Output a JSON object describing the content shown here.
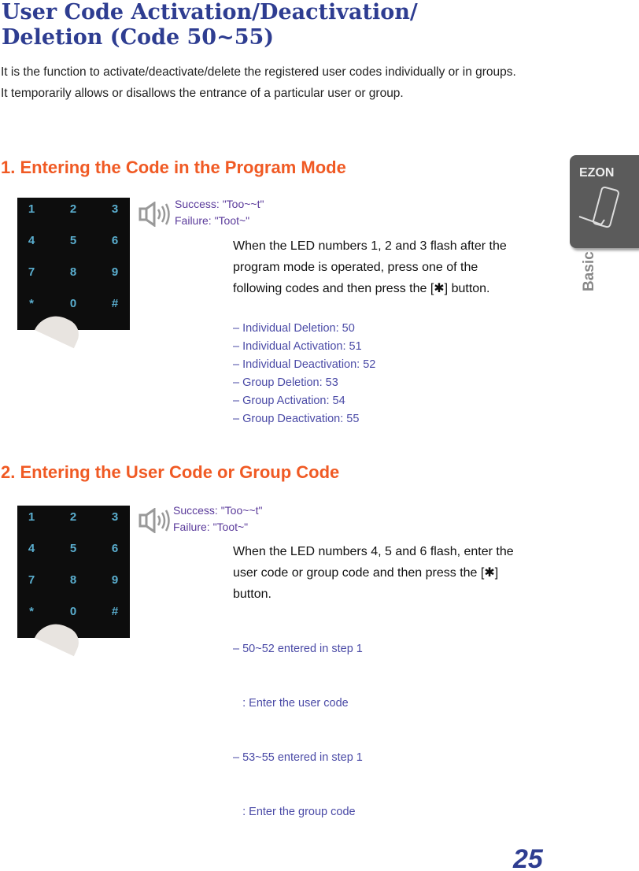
{
  "title_line1": "User Code Activation/Deactivation/",
  "title_line2": "Deletion (Code 50~55)",
  "intro": [
    "It is the function to activate/deactivate/delete the registered user codes individually or in groups.",
    "It temporarily allows or disallows the entrance of a particular user or group."
  ],
  "keypad_keys": [
    "1",
    "2",
    "3",
    "4",
    "5",
    "6",
    "7",
    "8",
    "9",
    "*",
    "0",
    "#"
  ],
  "feedback": {
    "success": "Success: \"Too~~t\"",
    "failure": "Failure: \"Toot~\""
  },
  "section1": {
    "heading": "1. Entering the Code in the Program Mode",
    "desc": "When the LED numbers 1, 2 and 3 flash after the program mode is operated, press one of the following codes and then press the [✱] button.",
    "items": [
      "– Individual Deletion: 50",
      "– Individual Activation: 51",
      "– Individual Deactivation: 52",
      "– Group Deletion: 53",
      "– Group Activation: 54",
      "– Group Deactivation: 55"
    ]
  },
  "section2": {
    "heading": "2. Entering the User Code or Group Code",
    "desc": "When the LED numbers 4, 5 and 6 flash, enter the user code or group code and then press the [✱] button.",
    "items": [
      "– 50~52 entered in step 1",
      "   : Enter the user code",
      "– 53~55 entered in step 1",
      "   : Enter the group code"
    ]
  },
  "side_tab": {
    "logo": "EZON",
    "label": "Basic"
  },
  "page_number": "25"
}
